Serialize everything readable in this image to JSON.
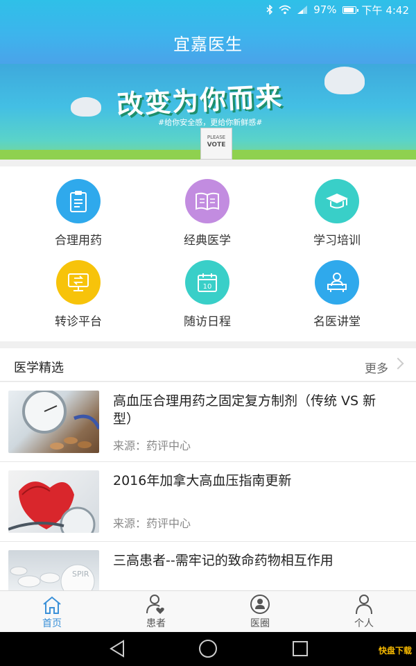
{
  "status_bar": {
    "battery": "97%",
    "time": "下午 4:42"
  },
  "header": {
    "title": "宜嘉医生"
  },
  "banner": {
    "headline": "改变为你而来",
    "subline": "#给你安全感，更给你新鲜感#",
    "vote_box_text_1": "PLEASE",
    "vote_box_text_2": "VOTE"
  },
  "grid": [
    {
      "label": "合理用药",
      "color": "#2fa9ec",
      "icon": "clipboard-icon"
    },
    {
      "label": "经典医学",
      "color": "#c28ce0",
      "icon": "book-icon"
    },
    {
      "label": "学习培训",
      "color": "#39cfc8",
      "icon": "graduation-cap-icon"
    },
    {
      "label": "转诊平台",
      "color": "#f7c30a",
      "icon": "transfer-icon"
    },
    {
      "label": "随访日程",
      "color": "#39cfc8",
      "icon": "calendar-icon",
      "calendar_day": "10"
    },
    {
      "label": "名医讲堂",
      "color": "#2fa9ec",
      "icon": "lecture-icon"
    }
  ],
  "section": {
    "title": "医学精选",
    "more": "更多"
  },
  "articles": [
    {
      "title": "高血压合理用药之固定复方制剂（传统 VS 新型）",
      "source": "来源：药评中心"
    },
    {
      "title": "2016年加拿大高血压指南更新",
      "source": "来源：药评中心"
    },
    {
      "title": "三高患者--需牢记的致命药物相互作用",
      "source": ""
    }
  ],
  "tabs": [
    {
      "label": "首页",
      "icon": "home-icon",
      "active": true
    },
    {
      "label": "患者",
      "icon": "patient-icon",
      "active": false
    },
    {
      "label": "医圈",
      "icon": "circle-icon",
      "active": false
    },
    {
      "label": "个人",
      "icon": "person-icon",
      "active": false
    }
  ],
  "watermark": "快盘下载",
  "colors": {
    "accent": "#3a90d8",
    "header": "#3db4ec"
  }
}
